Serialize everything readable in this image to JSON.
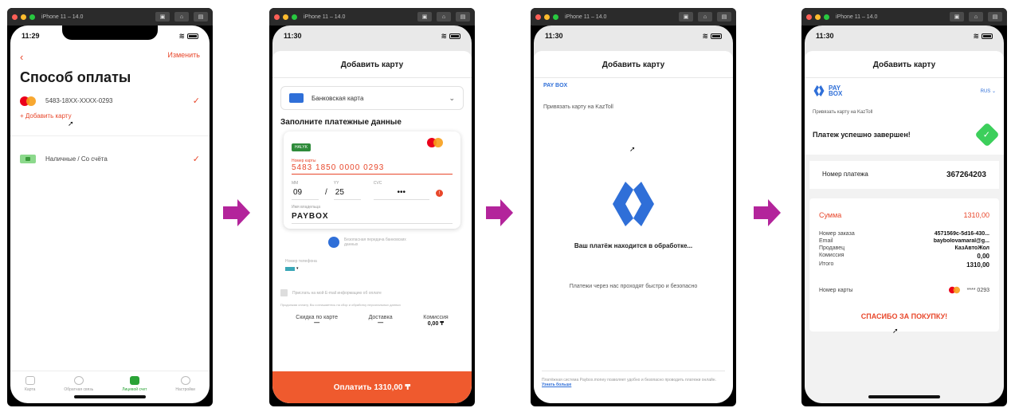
{
  "simulator": {
    "title_1": "iPhone 11 – 14.0",
    "title_2": "iPhone 11 – 14.0",
    "title_3": "iPhone 11 – 14.0",
    "title_4": "iPhone 11 – 14.0"
  },
  "screen1": {
    "time": "11:29",
    "back_icon": "chevron-left-icon",
    "edit": "Изменить",
    "title": "Способ оплаты",
    "card": "5483-18XX-XXXX-0293",
    "add_card": "+ Добавить карту",
    "cash": "Наличные / Со счёта",
    "tabs": [
      "Карта",
      "Обратная связь",
      "Лицевой счет",
      "Настройки"
    ]
  },
  "screen2": {
    "time": "11:30",
    "header": "Добавить карту",
    "select": "Банковская карта",
    "section": "Заполните платежные данные",
    "card_number_label": "Номер карты",
    "card_number": "5483 1850 0000 0293",
    "mm_label": "ММ",
    "mm": "09",
    "yy_label": "YY",
    "yy": "25",
    "cvc_label": "CVC",
    "cvc": "•••",
    "holder_label": "Имя владельца",
    "holder": "PAYBOX",
    "secure": "Безопасная передача банковских данных",
    "phone_label": "Номер телефона",
    "email_opt": "Прислать на мой E-mail информацию об оплате",
    "terms": "Продолжая оплату, Вы соглашаетесь на сбор и обработку персональных данных",
    "fees": [
      {
        "label": "Скидка по карте",
        "value": "—"
      },
      {
        "label": "Доставка",
        "value": "—"
      },
      {
        "label": "Комиссия",
        "value": "0,00 ₸"
      }
    ],
    "pay_button": "Оплатить 1310,00 ₸"
  },
  "screen3": {
    "time": "11:30",
    "header": "Добавить карту",
    "cut_logo": "PAY BOX",
    "link_text": "Привязать карту на KazToll",
    "processing": "Ваш платёж находится в обработке...",
    "safe": "Платежи через нас проходят быстро и безопасно",
    "footer": "Платёжная система Paybox.money позволяет удобно и безопасно проводить платежи онлайн.",
    "footer_link": "Узнать больше"
  },
  "screen4": {
    "time": "11:30",
    "header": "Добавить карту",
    "logo_top": "PAY",
    "logo_bottom": "BOX",
    "lang": "RUS",
    "link_text": "Привязать карту на KazToll",
    "success": "Платеж успешно завершен!",
    "payment_number_label": "Номер платежа",
    "payment_number": "367264203",
    "sum_label": "Сумма",
    "sum": "1310,00",
    "rows": [
      {
        "label": "Номер заказа",
        "value": "4571569c-5d16-430..."
      },
      {
        "label": "Email",
        "value": "baybolovamaral@g..."
      },
      {
        "label": "Продавец",
        "value": "КазАвтоЖол"
      },
      {
        "label": "Комиссия",
        "value": "0,00"
      },
      {
        "label": "Итого",
        "value": "1310,00"
      }
    ],
    "card_label": "Номер карты",
    "card_value": "**** 0293",
    "thanks": "СПАСИБО ЗА ПОКУПКУ!"
  },
  "colors": {
    "accent": "#e8472b",
    "pay_button": "#ef5a2e",
    "arrow": "#b3249b",
    "paybox_blue": "#2f6fd8",
    "success_green": "#3ccf5b"
  }
}
